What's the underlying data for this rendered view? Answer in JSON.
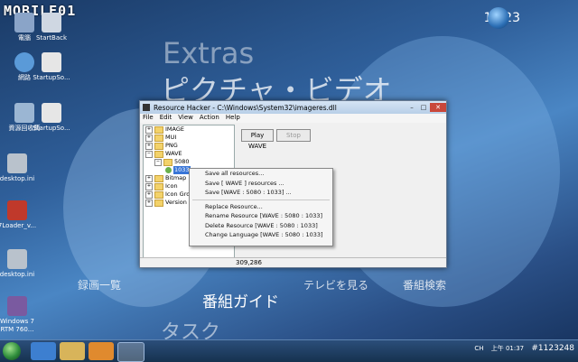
{
  "watermark": "MOBILE01",
  "copyright_tag": "#1123248",
  "clock": "19:23",
  "wallpaper_text": {
    "extras": "Extras",
    "picture_video": "ピクチャ・ビデオ",
    "recorded_list": "録画一覧",
    "tv_guide": "番組ガイド",
    "watch_tv": "テレビを見る",
    "program_search": "番組検索",
    "tasks": "タスク"
  },
  "desktop_icons": [
    {
      "label": "電腦",
      "color": "#8aa4c8"
    },
    {
      "label": "StartBack",
      "color": "#cfd7e2"
    },
    {
      "label": "網路",
      "color": "#5a9ad8"
    },
    {
      "label": "StartupSo...",
      "color": "#e6e6e6"
    },
    {
      "label": "資源回收筒",
      "color": "#9bb6d3"
    },
    {
      "label": "StartupSo...",
      "color": "#e6e6e6"
    },
    {
      "label": "desktop.ini",
      "color": "#b9c2cc"
    },
    {
      "label": "7Loader_v...",
      "color": "#c0392b"
    },
    {
      "label": "desktop.ini",
      "color": "#b9c2cc"
    },
    {
      "label": "Windows 7 RTM 760...",
      "color": "#7a5aa0"
    }
  ],
  "window": {
    "title": "Resource Hacker  -  C:\\Windows\\System32\\imageres.dll",
    "menu": [
      "File",
      "Edit",
      "View",
      "Action",
      "Help"
    ],
    "tree": [
      {
        "label": "IMAGE",
        "exp": "+",
        "indent": 0
      },
      {
        "label": "MUI",
        "exp": "+",
        "indent": 0
      },
      {
        "label": "PNG",
        "exp": "+",
        "indent": 0
      },
      {
        "label": "WAVE",
        "exp": "−",
        "indent": 0
      },
      {
        "label": "5080",
        "exp": "−",
        "indent": 1
      },
      {
        "label": "1033",
        "exp": "",
        "indent": 2,
        "selected": true
      },
      {
        "label": "Bitmap",
        "exp": "+",
        "indent": 0
      },
      {
        "label": "Icon",
        "exp": "+",
        "indent": 0
      },
      {
        "label": "Icon Group",
        "exp": "+",
        "indent": 0
      },
      {
        "label": "Version Info",
        "exp": "+",
        "indent": 0
      }
    ],
    "play_button": "Play WAVE",
    "stop_button": "Stop",
    "status_value": "309,286"
  },
  "context_menu": {
    "group1": [
      "Save all resources...",
      "Save [ WAVE ] resources ...",
      "Save [WAVE : 5080 : 1033] ..."
    ],
    "group2": [
      "Replace Resource...",
      "Rename Resource [WAVE : 5080 : 1033]",
      "Delete Resource [WAVE : 5080 : 1033]",
      "Change Language [WAVE : 5080 : 1033]"
    ]
  },
  "taskbar": {
    "tray_text": "CH",
    "tray_clock": "上午 01:37"
  }
}
